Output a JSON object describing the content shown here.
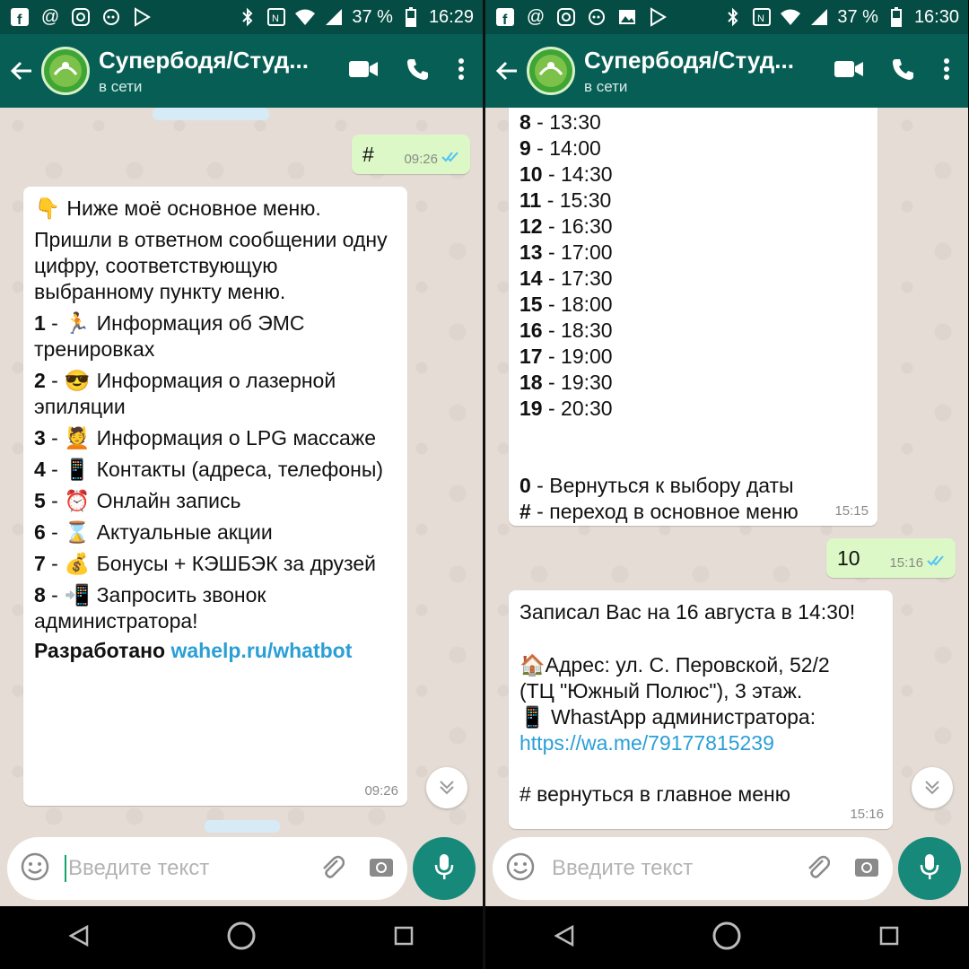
{
  "colors": {
    "status_bar": "#054d44",
    "app_bar": "#075e54",
    "outgoing_bubble": "#dcf8c6",
    "incoming_bubble": "#ffffff",
    "link": "#2a9fd6",
    "mic_button": "#16897a",
    "read_ticks": "#4fc3f7"
  },
  "screens": [
    {
      "status": {
        "battery": "37 %",
        "time": "16:29"
      },
      "chat": {
        "title": "Супербодя/Студ...",
        "subtitle": "в сети"
      },
      "messages": {
        "out1": {
          "text": "#",
          "time": "09:26"
        },
        "menu": {
          "intro_emoji": "👇",
          "intro_line": "Ниже моё основное меню.",
          "intro_body": "Пришли в ответном сообщении одну цифру, соответствующую выбранному пункту меню.",
          "items": [
            {
              "num": "1",
              "emoji": "🏃",
              "text": "Информация об ЭМС тренировках"
            },
            {
              "num": "2",
              "emoji": "😎",
              "text": "Информация о лазерной эпиляции"
            },
            {
              "num": "3",
              "emoji": "💆",
              "text": "Информация о LPG массаже"
            },
            {
              "num": "4",
              "emoji": "📱",
              "text": "Контакты (адреса, телефоны)"
            },
            {
              "num": "5",
              "emoji": "⏰",
              "text": "Онлайн запись"
            },
            {
              "num": "6",
              "emoji": "⌛",
              "text": "Актуальные акции"
            },
            {
              "num": "7",
              "emoji": "💰",
              "text": "Бонусы + КЭШБЭК за друзей"
            },
            {
              "num": "8",
              "emoji": "📲",
              "text": "Запросить звонок администратора!"
            }
          ],
          "footer_label": "Разработано",
          "footer_link": "wahelp.ru/whatbot",
          "time": "09:26"
        }
      },
      "input": {
        "placeholder": "Введите текст"
      }
    },
    {
      "status": {
        "battery": "37 %",
        "time": "16:30"
      },
      "chat": {
        "title": "Супербодя/Студ...",
        "subtitle": "в сети"
      },
      "messages": {
        "slots": {
          "items": [
            {
              "num": "8",
              "text": " - 13:30"
            },
            {
              "num": "9",
              "text": " - 14:00"
            },
            {
              "num": "10",
              "text": " - 14:30"
            },
            {
              "num": "11",
              "text": " - 15:30"
            },
            {
              "num": "12",
              "text": " - 16:30"
            },
            {
              "num": "13",
              "text": " - 17:00"
            },
            {
              "num": "14",
              "text": " - 17:30"
            },
            {
              "num": "15",
              "text": " - 18:00"
            },
            {
              "num": "16",
              "text": " - 18:30"
            },
            {
              "num": "17",
              "text": " - 19:00"
            },
            {
              "num": "18",
              "text": " - 19:30"
            },
            {
              "num": "19",
              "text": " - 20:30"
            }
          ],
          "back_num": "0",
          "back_text": " - Вернуться к выбору даты",
          "menu_num": "#",
          "menu_text": " - переход в основное меню",
          "time": "15:15"
        },
        "out2": {
          "text": "10",
          "time": "15:16"
        },
        "confirm": {
          "line1": "Записал Вас на 16 августа в 14:30!",
          "address_emoji": "🏠",
          "address_line1": "Адрес: ул. С. Перовской, 52/2",
          "address_line2": "(ТЦ \"Южный Полюс\"), 3 этаж.",
          "whatsapp_emoji": "📱",
          "whatsapp_label": "WhastApp администратора:",
          "link": "https://wa.me/79177815239",
          "back": "# вернуться в главное меню",
          "time": "15:16"
        }
      },
      "input": {
        "placeholder": "Введите текст"
      }
    }
  ]
}
